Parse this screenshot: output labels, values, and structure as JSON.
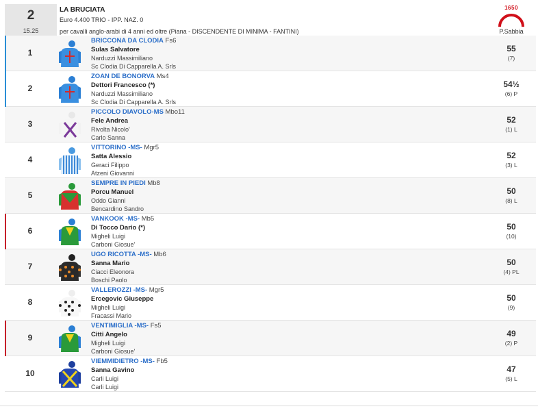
{
  "race": {
    "number": "2",
    "time": "15.25",
    "name": "LA BRUCIATA",
    "prize": "Euro 4.400 TRIO - IPP. NAZ. 0",
    "conditions": "per cavalli anglo-arabi di 4 anni ed oltre (Piana -  DISCENDENTE DI MINIMA  - FANTINI)",
    "distance": "1650",
    "surface": "P.Sabbia"
  },
  "colors": {
    "horse_name": "#2c6fc9",
    "marker_blue": "#2a8ed6",
    "marker_red": "#c61f2a",
    "track_red": "#d0101a"
  },
  "runners": [
    {
      "number": "1",
      "horse": "BRICCONA DA CLODIA",
      "form": "Fs6",
      "jockey": "Sulas Salvatore",
      "trainer": "Narduzzi Massimiliano",
      "owner": "Sc Clodia Di Capparella A. Srls",
      "weight": "55",
      "draw": "(7)",
      "marker": "blue",
      "silk": "silk-blue-red-cross"
    },
    {
      "number": "2",
      "horse": "ZOAN DE BONORVA",
      "form": "Ms4",
      "jockey": "Dettori Francesco (*)",
      "trainer": "Narduzzi Massimiliano",
      "owner": "Sc Clodia Di Capparella A. Srls",
      "weight": "54½",
      "draw": "(6) P",
      "marker": "blue",
      "silk": "silk-blue-red-cross"
    },
    {
      "number": "3",
      "horse": "PICCOLO DIAVOLO-MS",
      "form": "Mbo11",
      "jockey": "Fele Andrea",
      "trainer": "Rivolta Nicolo'",
      "owner": "Carlo Sanna",
      "weight": "52",
      "draw": "(1) L",
      "marker": "none",
      "silk": "silk-white-purple-cross"
    },
    {
      "number": "4",
      "horse": "VITTORINO -MS-",
      "form": "Mgr5",
      "jockey": "Satta Alessio",
      "trainer": "Geraci Filippo",
      "owner": "Atzeni Giovanni",
      "weight": "52",
      "draw": "(3) L",
      "marker": "none",
      "silk": "silk-blue-white-stripes"
    },
    {
      "number": "5",
      "horse": "SEMPRE IN PIEDI",
      "form": "Mb8",
      "jockey": "Porcu Manuel",
      "trainer": "Oddo Gianni",
      "owner": "Bencardino Sandro",
      "weight": "50",
      "draw": "(8) L",
      "marker": "none",
      "silk": "silk-green-red"
    },
    {
      "number": "6",
      "horse": "VANKOOK -MS-",
      "form": "Mb5",
      "jockey": "Di Tocco Dario (*)",
      "trainer": "Migheli Luigi",
      "owner": "Carboni Giosue'",
      "weight": "50",
      "draw": "(10)",
      "marker": "red",
      "silk": "silk-green-yellow-blue"
    },
    {
      "number": "7",
      "horse": "UGO RICOTTA -MS-",
      "form": "Mb6",
      "jockey": "Sanna Mario",
      "trainer": "Ciacci Eleonora",
      "owner": "Boschi Paolo",
      "weight": "50",
      "draw": "(4) PL",
      "marker": "none",
      "silk": "silk-black-orange-dots"
    },
    {
      "number": "8",
      "horse": "VALLEROZZI -MS-",
      "form": "Mgr5",
      "jockey": "Ercegovic Giuseppe",
      "trainer": "Migheli Luigi",
      "owner": "Fracassi Mario",
      "weight": "50",
      "draw": "(9)",
      "marker": "none",
      "silk": "silk-white-black-dots"
    },
    {
      "number": "9",
      "horse": "VENTIMIGLIA -MS-",
      "form": "Fs5",
      "jockey": "Citti Angelo",
      "trainer": "Migheli Luigi",
      "owner": "Carboni Giosue'",
      "weight": "49",
      "draw": "(2) P",
      "marker": "red",
      "silk": "silk-green-yellow-blue"
    },
    {
      "number": "10",
      "horse": "VIEMMIDIETRO -MS-",
      "form": "Fb5",
      "jockey": "Sanna Gavino",
      "trainer": "Carli Luigi",
      "owner": "Carli Luigi",
      "weight": "47",
      "draw": "(5) L",
      "marker": "none",
      "silk": "silk-blue-yellow-cross"
    }
  ]
}
